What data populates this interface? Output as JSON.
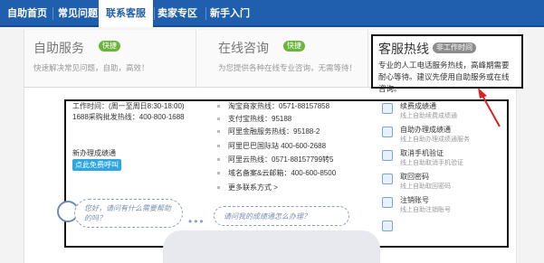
{
  "topnav": {
    "items": [
      {
        "label": "自助首页"
      },
      {
        "label": "常见问题"
      },
      {
        "label": "联系客服"
      },
      {
        "label": "卖家专区"
      },
      {
        "label": "新手入门"
      }
    ]
  },
  "columns": {
    "self": {
      "title": "自助服务",
      "badge": "快捷",
      "desc": "快速解决常见问题，自助，高效！"
    },
    "online": {
      "title": "在线咨询",
      "badge": "快捷",
      "desc": "为您提供各种在线专业咨询，无需等待！"
    },
    "hotline": {
      "title": "客服热线",
      "badge": "非工作时间",
      "desc": "专业的人工电话服务热线，高峰期需要耐心等待。建议先使用自助服务或在线咨询。"
    }
  },
  "left": {
    "worktime": "工作时间：(周一至周日8:30-18:00)",
    "hotline1688": "1688采购批发热线：400-800-1688",
    "newchannel": "新办理成绩通",
    "call_button": "点此免费呼叫"
  },
  "hotlines": [
    "淘宝商家热线：0571-88157858",
    "支付宝热线：95188",
    "阿里金融服务热线：95188-2",
    "阿里巴巴国际站 400-600-2688",
    "阿里云热线：0571-88157799转5",
    "域名备案&云邮箱：400-600-8500",
    "更多联系方式 >"
  ],
  "services": [
    {
      "title": "续费成绩通",
      "sub": "线上自助续费成绩通"
    },
    {
      "title": "自助办理成绩通",
      "sub": "线上自助办理成绩通服务"
    },
    {
      "title": "取消手机验证",
      "sub": "线上自助取消手机验证"
    },
    {
      "title": "取回密码",
      "sub": "线上自助取回密码"
    },
    {
      "title": "注销账号",
      "sub": "线上自助注销账号"
    },
    {
      "title": "",
      "sub": ""
    }
  ],
  "bubbles": {
    "left": "您好，请问有什么需要帮助的吗？",
    "right": "请问我的成绩通怎么办理？"
  },
  "colors": {
    "nav_blue": "#1f5fae",
    "badge_green": "#6bb53b",
    "call_blue": "#2ea7e0",
    "annotation_red": "#e02020"
  }
}
